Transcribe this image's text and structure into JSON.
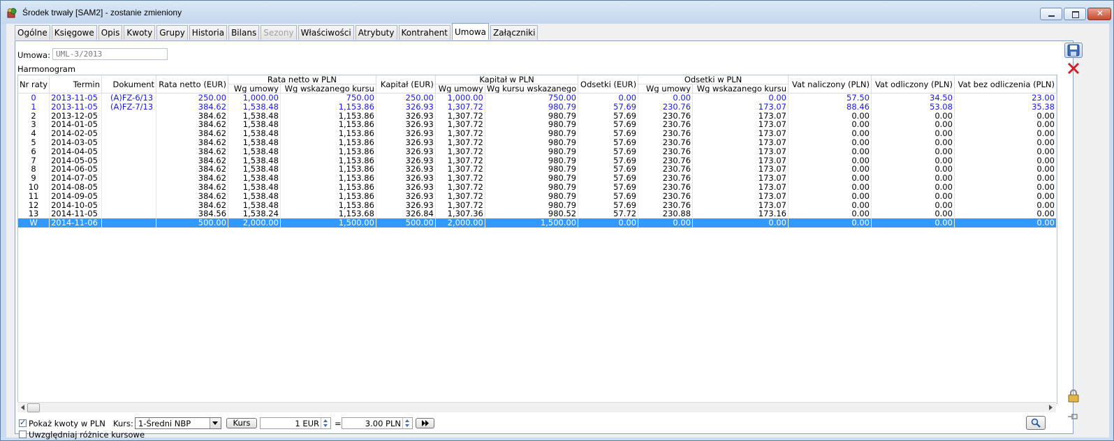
{
  "window": {
    "title": "Środek trwały [SAM2] - zostanie zmieniony"
  },
  "tabs": [
    {
      "label": "Ogólne",
      "state": "normal"
    },
    {
      "label": "Księgowe",
      "state": "normal"
    },
    {
      "label": "Opis",
      "state": "normal"
    },
    {
      "label": "Kwoty",
      "state": "normal"
    },
    {
      "label": "Grupy",
      "state": "normal"
    },
    {
      "label": "Historia",
      "state": "normal"
    },
    {
      "label": "Bilans",
      "state": "normal"
    },
    {
      "label": "Sezony",
      "state": "disabled"
    },
    {
      "label": "Właściwości",
      "state": "normal"
    },
    {
      "label": "Atrybuty",
      "state": "normal"
    },
    {
      "label": "Kontrahent",
      "state": "normal"
    },
    {
      "label": "Umowa",
      "state": "active"
    },
    {
      "label": "Załączniki",
      "state": "normal"
    }
  ],
  "form": {
    "umowa_label": "Umowa:",
    "umowa_value": "UML-3/2013",
    "harmonogram_label": "Harmonogram"
  },
  "grid": {
    "group_headers": {
      "rata_pln": "Rata netto w PLN",
      "kapital_pln": "Kapitał w PLN",
      "odsetki_pln": "Odsetki w PLN"
    },
    "headers": {
      "nr": "Nr raty",
      "termin": "Termin",
      "dokument": "Dokument",
      "rata_eur": "Rata netto (EUR)",
      "rata_umowy": "Wg umowy",
      "rata_kursu": "Wg wskazanego kursu",
      "kapital_eur": "Kapitał (EUR)",
      "kapital_umowy": "Wg umowy",
      "kapital_kursu": "Wg kursu wskazanego",
      "odsetki_eur": "Odsetki (EUR)",
      "odsetki_umowy": "Wg umowy",
      "odsetki_kursu": "Wg wskazanego kursu",
      "vat_naliczony": "Vat naliczony (PLN)",
      "vat_odliczony": "Vat odliczony (PLN)",
      "vat_bez": "Vat bez odliczenia (PLN)"
    },
    "rows": [
      {
        "style": "blue",
        "cells": [
          "0",
          "2013-11-05",
          "(A)FZ-6/13",
          "250.00",
          "1,000.00",
          "750.00",
          "250.00",
          "1,000.00",
          "750.00",
          "0.00",
          "0.00",
          "0.00",
          "57.50",
          "34.50",
          "23.00"
        ]
      },
      {
        "style": "blue",
        "cells": [
          "1",
          "2013-11-05",
          "(A)FZ-7/13",
          "384.62",
          "1,538.48",
          "1,153.86",
          "326.93",
          "1,307.72",
          "980.79",
          "57.69",
          "230.76",
          "173.07",
          "88.46",
          "53.08",
          "35.38"
        ]
      },
      {
        "style": "normal",
        "cells": [
          "2",
          "2013-12-05",
          "",
          "384.62",
          "1,538.48",
          "1,153.86",
          "326.93",
          "1,307.72",
          "980.79",
          "57.69",
          "230.76",
          "173.07",
          "0.00",
          "0.00",
          "0.00"
        ]
      },
      {
        "style": "normal",
        "cells": [
          "3",
          "2014-01-05",
          "",
          "384.62",
          "1,538.48",
          "1,153.86",
          "326.93",
          "1,307.72",
          "980.79",
          "57.69",
          "230.76",
          "173.07",
          "0.00",
          "0.00",
          "0.00"
        ]
      },
      {
        "style": "normal",
        "cells": [
          "4",
          "2014-02-05",
          "",
          "384.62",
          "1,538.48",
          "1,153.86",
          "326.93",
          "1,307.72",
          "980.79",
          "57.69",
          "230.76",
          "173.07",
          "0.00",
          "0.00",
          "0.00"
        ]
      },
      {
        "style": "normal",
        "cells": [
          "5",
          "2014-03-05",
          "",
          "384.62",
          "1,538.48",
          "1,153.86",
          "326.93",
          "1,307.72",
          "980.79",
          "57.69",
          "230.76",
          "173.07",
          "0.00",
          "0.00",
          "0.00"
        ]
      },
      {
        "style": "normal",
        "cells": [
          "6",
          "2014-04-05",
          "",
          "384.62",
          "1,538.48",
          "1,153.86",
          "326.93",
          "1,307.72",
          "980.79",
          "57.69",
          "230.76",
          "173.07",
          "0.00",
          "0.00",
          "0.00"
        ]
      },
      {
        "style": "normal",
        "cells": [
          "7",
          "2014-05-05",
          "",
          "384.62",
          "1,538.48",
          "1,153.86",
          "326.93",
          "1,307.72",
          "980.79",
          "57.69",
          "230.76",
          "173.07",
          "0.00",
          "0.00",
          "0.00"
        ]
      },
      {
        "style": "normal",
        "cells": [
          "8",
          "2014-06-05",
          "",
          "384.62",
          "1,538.48",
          "1,153.86",
          "326.93",
          "1,307.72",
          "980.79",
          "57.69",
          "230.76",
          "173.07",
          "0.00",
          "0.00",
          "0.00"
        ]
      },
      {
        "style": "normal",
        "cells": [
          "9",
          "2014-07-05",
          "",
          "384.62",
          "1,538.48",
          "1,153.86",
          "326.93",
          "1,307.72",
          "980.79",
          "57.69",
          "230.76",
          "173.07",
          "0.00",
          "0.00",
          "0.00"
        ]
      },
      {
        "style": "normal",
        "cells": [
          "10",
          "2014-08-05",
          "",
          "384.62",
          "1,538.48",
          "1,153.86",
          "326.93",
          "1,307.72",
          "980.79",
          "57.69",
          "230.76",
          "173.07",
          "0.00",
          "0.00",
          "0.00"
        ]
      },
      {
        "style": "normal",
        "cells": [
          "11",
          "2014-09-05",
          "",
          "384.62",
          "1,538.48",
          "1,153.86",
          "326.93",
          "1,307.72",
          "980.79",
          "57.69",
          "230.76",
          "173.07",
          "0.00",
          "0.00",
          "0.00"
        ]
      },
      {
        "style": "normal",
        "cells": [
          "12",
          "2014-10-05",
          "",
          "384.62",
          "1,538.48",
          "1,153.86",
          "326.93",
          "1,307.72",
          "980.79",
          "57.69",
          "230.76",
          "173.07",
          "0.00",
          "0.00",
          "0.00"
        ]
      },
      {
        "style": "normal",
        "cells": [
          "13",
          "2014-11-05",
          "",
          "384.56",
          "1,538.24",
          "1,153.68",
          "326.84",
          "1,307.36",
          "980.52",
          "57.72",
          "230.88",
          "173.16",
          "0.00",
          "0.00",
          "0.00"
        ]
      },
      {
        "style": "selected",
        "cells": [
          "W",
          "2014-11-06",
          "",
          "500.00",
          "2,000.00",
          "1,500.00",
          "500.00",
          "2,000.00",
          "1,500.00",
          "0.00",
          "0.00",
          "0.00",
          "0.00",
          "0.00",
          "0.00"
        ]
      }
    ]
  },
  "bottom": {
    "show_pln_label": "Pokaż kwoty w PLN",
    "show_pln_checked": true,
    "kurs_label": "Kurs:",
    "kurs_select": "1-Średni NBP",
    "kurs_button": "Kurs",
    "amount_eur": "1 EUR",
    "equals": "=",
    "amount_pln": "3.00 PLN",
    "diff_label": "Uwzględniaj różnice kursowe",
    "diff_checked": false
  },
  "icons": {
    "app": "asset-icon",
    "save": "floppy-disk-icon",
    "cancel": "red-x-icon",
    "lock": "padlock-icon",
    "pin": "pin-icon",
    "search": "magnifier-icon",
    "forward": "double-arrow-right-icon"
  },
  "colors": {
    "link_blue": "#1a1ad4",
    "selection": "#3399ff",
    "accent": "#8aa2c2"
  }
}
